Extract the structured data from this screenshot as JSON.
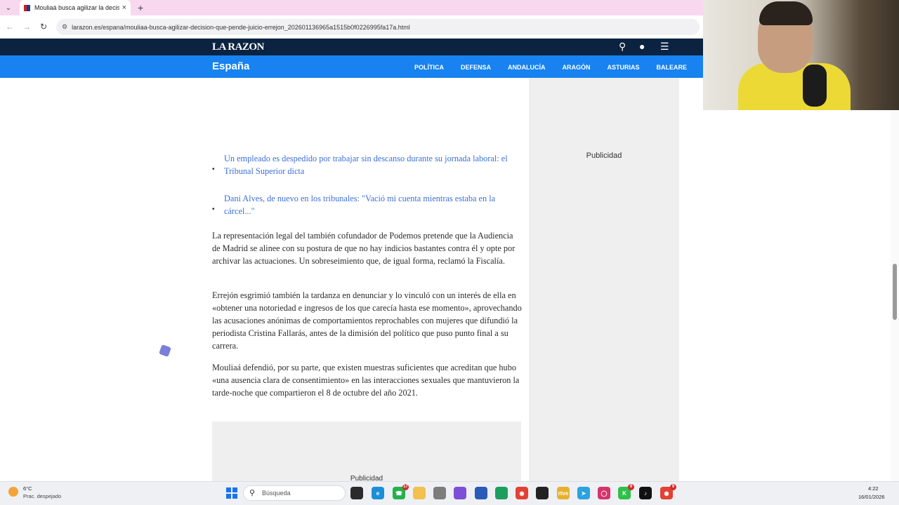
{
  "browser": {
    "tab_title": "Mouliaá busca agilizar la decisión",
    "url": "larazon.es/espana/mouliaa-busca-agilizar-decision-que-pende-juicio-errejon_202601136965a1515b0f0226995fa17a.html"
  },
  "site": {
    "logo": "LA RAZON",
    "section": "España",
    "nav": [
      "POLÍTICA",
      "DEFENSA",
      "ANDALUCÍA",
      "ARAGÓN",
      "ASTURIAS",
      "BALEARE"
    ]
  },
  "article": {
    "related": [
      "Un empleado es despedido por trabajar sin descanso durante su jornada laboral: el Tribunal Superior dicta",
      "Dani Alves, de nuevo en los tribunales: \"Vació mi cuenta mientras estaba en la cárcel...\""
    ],
    "paragraphs": [
      "La representación legal del también cofundador de Podemos pretende que la Audiencia de Madrid se alinee con su postura de que no hay indicios bastantes contra él y opte por archivar las actuaciones. Un sobreseimiento que, de igual forma, reclamó la Fiscalía.",
      "Errejón esgrimió también la tardanza en denunciar y lo vinculó con un interés de ella en «obtener una notoriedad e ingresos de los que carecía hasta ese momento», aprovechando las acusaciones anónimas de comportamientos reprochables con mujeres que difundió la periodista Cristina Fallarás, antes de la dimisión del político que puso punto final a su carrera.",
      "Mouliaá defendió, por su parte, que existen muestras suficientes que acreditan que hubo «una ausencia clara de consentimiento» en las interacciones sexuales que mantuvieron la tarde-noche que compartieron el 8 de octubre del año 2021."
    ],
    "ad_label": "Publicidad"
  },
  "sidebar": {
    "ad_label": "Publicidad"
  },
  "taskbar": {
    "weather_temp": "6°C",
    "weather_desc": "Prac. despejado",
    "search_placeholder": "Búsqueda",
    "time": "4:22",
    "date": "16/01/2026",
    "badges": {
      "whatsapp": "17",
      "app_k": "9",
      "chrome": "9"
    }
  },
  "colors": {
    "header_dark": "#0b2341",
    "nav_blue": "#1782f0",
    "link": "#3d6fd6"
  }
}
